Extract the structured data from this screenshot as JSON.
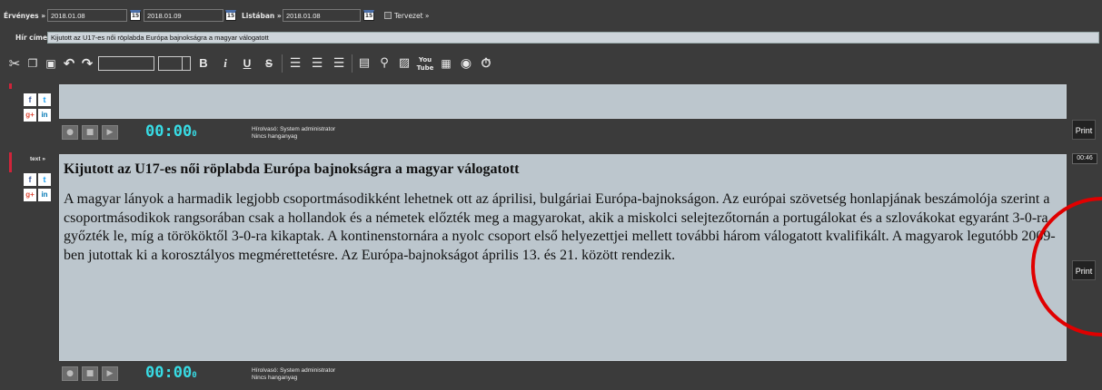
{
  "topbar": {
    "ervenyes_label": "Érvényes »",
    "date_from": "2018.01.08",
    "date_to": "2018.01.09",
    "listaban_label": "Listában »",
    "list_date": "2018.01.08",
    "calendar_day": "15",
    "tervezet_label": "Tervezet »"
  },
  "title_row": {
    "label": "Hír címe",
    "value": "Kijutott az U17-es női röplabda Európa bajnokságra a magyar válogatott"
  },
  "social": {
    "facebook": "f",
    "twitter": "t",
    "gplus": "g+",
    "linkedin": "in"
  },
  "block1": {
    "print_label": "Print",
    "timer": "00:00",
    "timer_sub": "0",
    "reader": "Hírolvasó: System administrator",
    "audio": "Nincs hanganyag"
  },
  "block2": {
    "tag": "text »",
    "duration": "00:46",
    "print_label": "Print",
    "heading": "Kijutott az U17-es női röplabda Európa bajnokságra a magyar válogatott",
    "body": "A magyar lányok a harmadik legjobb csoportmásodikként lehetnek ott az áprilisi, bulgáriai Európa-bajnokságon. Az európai szövetség honlapjának beszámolója szerint a csoportmásodikok rangsorában csak a hollandok és a németek előzték meg a magyarokat, akik a miskolci selejtezőtornán a portugálokat és a szlovákokat egyaránt 3-0-ra győzték le, míg a törököktől 3-0-ra kikaptak.  A kontinenstornára a nyolc csoport első helyezettjei mellett további három válogatott kvalifikált. A magyarok legutóbb 2009-ben jutottak ki a korosztályos megmérettetésre. Az Európa-bajnokságot április 13. és 21. között rendezik.",
    "timer": "00:00",
    "timer_sub": "0",
    "reader": "Hírolvasó: System administrator",
    "audio": "Nincs hanganyag"
  },
  "colors": {
    "accent_timer": "#38dce5",
    "annotation_circle": "#e00000",
    "tag_red": "#d0243a"
  }
}
